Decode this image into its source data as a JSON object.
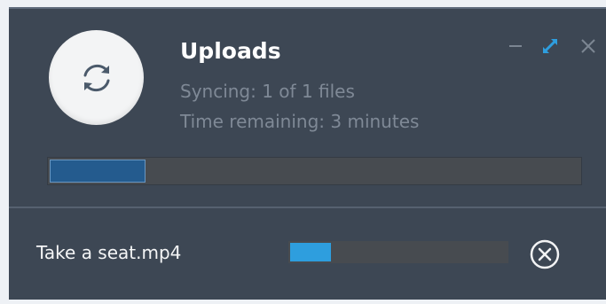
{
  "panel": {
    "title": "Uploads",
    "status_text": "Syncing: 1 of 1 files",
    "time_remaining_text": "Time remaining: 3 minutes",
    "overall_progress": 0.18,
    "window_controls": {
      "minimize_icon": "minimize-icon",
      "expand_icon": "expand-icon",
      "close_icon": "close-icon"
    },
    "sync_icon": "sync-icon"
  },
  "file": {
    "name": "Take a seat.mp4",
    "progress": 0.19,
    "cancel_icon": "cancel-circle-icon"
  },
  "colors": {
    "panel_bg": "#3d4754",
    "accent": "#2e9ede",
    "overall_fill": "#245b8e",
    "track": "#474b50"
  }
}
